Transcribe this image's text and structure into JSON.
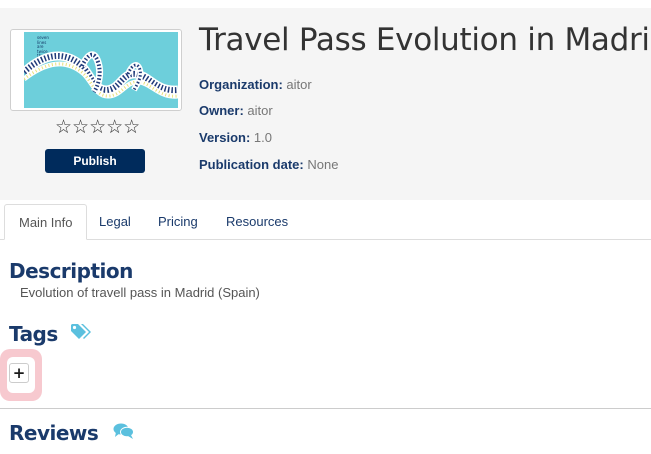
{
  "product": {
    "title": "Travel Pass Evolution in Madrid",
    "rating_stars": "☆☆☆☆☆",
    "thumbnail_text": [
      "seven",
      "lines",
      "are",
      "twice",
      "the",
      "magic"
    ],
    "publish_label": "Publish",
    "metadata": [
      {
        "label": "Organization:",
        "value": "aitor"
      },
      {
        "label": "Owner:",
        "value": "aitor"
      },
      {
        "label": "Version:",
        "value": "1.0"
      },
      {
        "label": "Publication date:",
        "value": "None"
      }
    ]
  },
  "tabs": [
    {
      "label": "Main Info",
      "active": true
    },
    {
      "label": "Legal",
      "active": false
    },
    {
      "label": "Pricing",
      "active": false
    },
    {
      "label": "Resources",
      "active": false
    }
  ],
  "description": {
    "title": "Description",
    "text": "Evolution of travell pass in Madrid (Spain)"
  },
  "tags": {
    "title": "Tags",
    "icon": "tags-icon",
    "add_label": "+"
  },
  "reviews": {
    "title": "Reviews",
    "icon": "comments-icon"
  },
  "colors": {
    "accent": "#1a3a6b",
    "publish_bg": "#002b5c",
    "icon_color": "#5bc0de",
    "highlight": "#f7c9cf",
    "thumbnail_bg": "#6dcfdb"
  }
}
